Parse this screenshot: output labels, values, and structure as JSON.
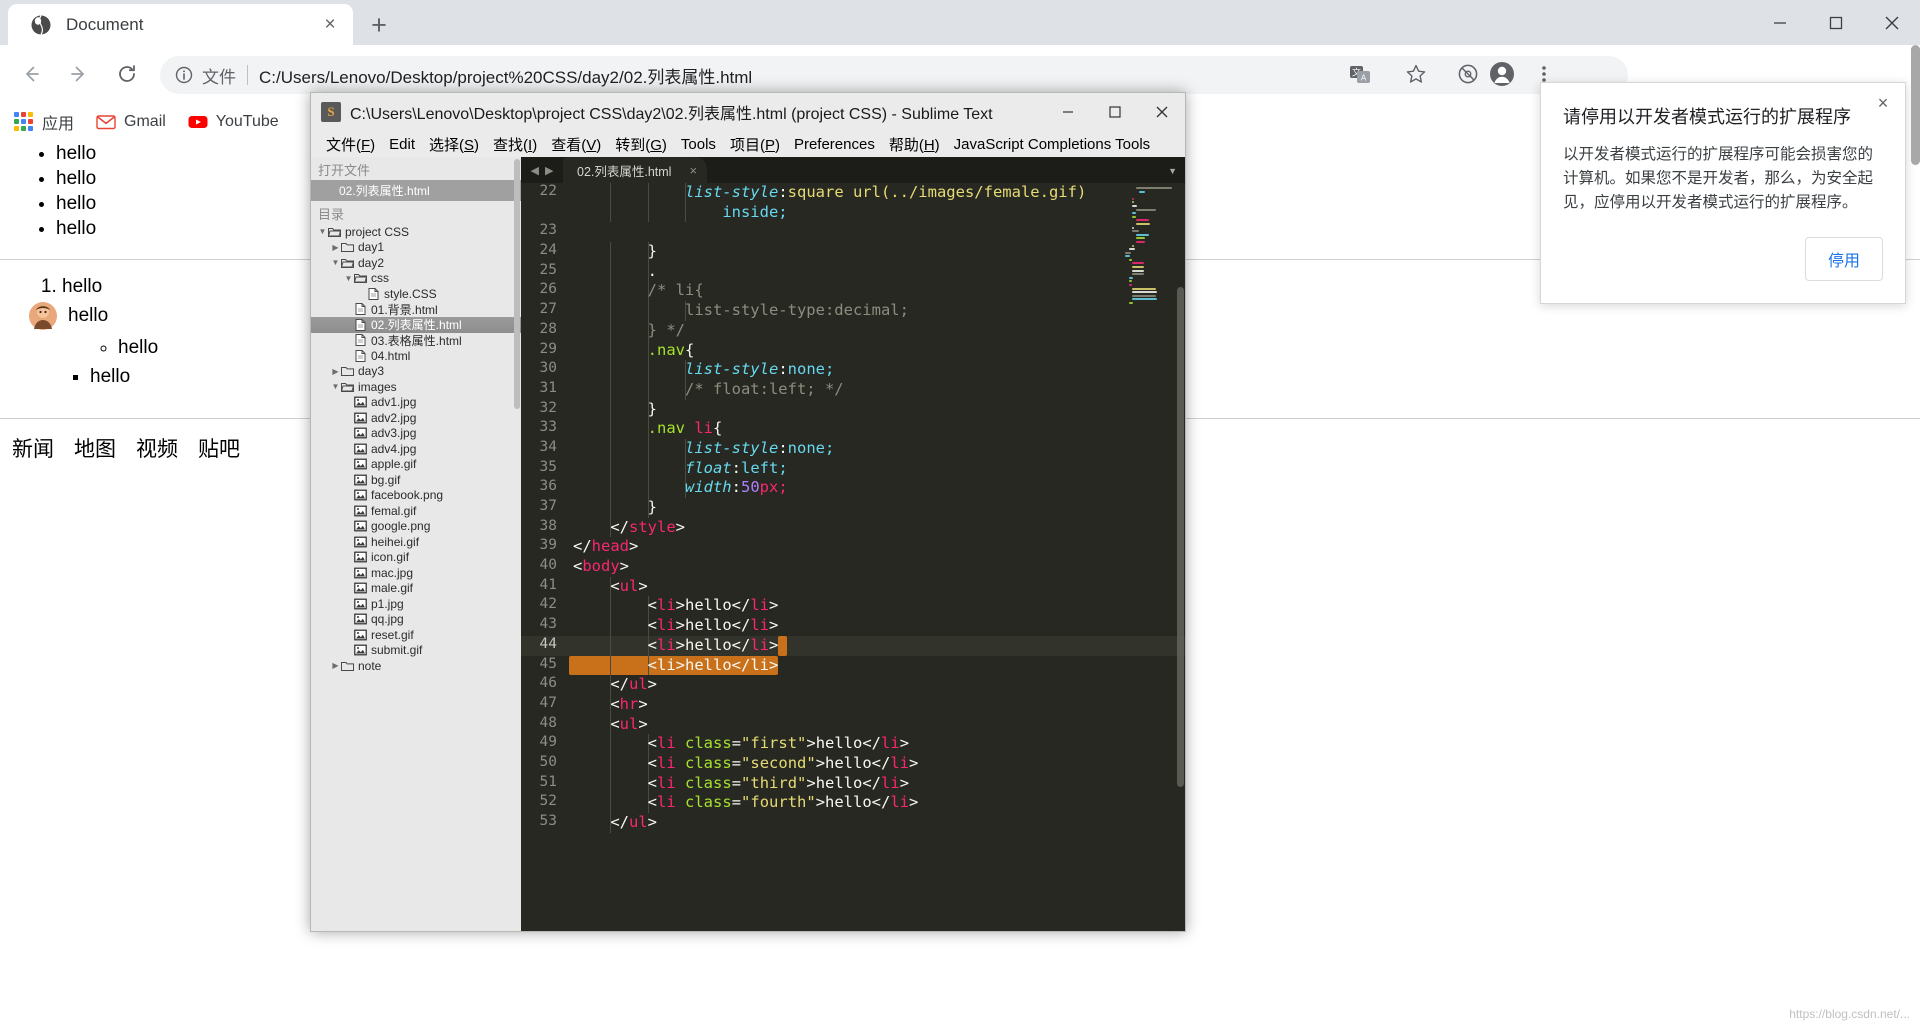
{
  "browser": {
    "tab": {
      "title": "Document",
      "favicon": "globe-icon",
      "close": "×"
    },
    "newtab": "+",
    "window_controls": {
      "minimize": "minimize-icon",
      "maximize": "maximize-icon",
      "close": "close-icon"
    },
    "nav": {
      "back": "back-arrow-icon",
      "forward": "forward-arrow-icon",
      "reload": "reload-icon"
    },
    "omnibox": {
      "info_icon": "info-circle-icon",
      "scheme_label": "文件",
      "url": "C:/Users/Lenovo/Desktop/project%20CSS/day2/02.列表属性.html"
    },
    "toolbar_icons": [
      "translate-icon",
      "star-icon",
      "extension-blocked-icon",
      "profile-icon",
      "more-menu-icon"
    ],
    "bookmarks": [
      {
        "label": "应用",
        "icon": "apps-grid-icon"
      },
      {
        "label": "Gmail",
        "icon": "gmail-icon"
      },
      {
        "label": "YouTube",
        "icon": "youtube-icon"
      }
    ]
  },
  "page": {
    "list1": [
      "hello",
      "hello",
      "hello",
      "hello"
    ],
    "ordered": [
      "hello"
    ],
    "avatar_item": "hello",
    "circle_list": [
      "hello"
    ],
    "square_list": [
      "hello"
    ],
    "nav_items": [
      "新闻",
      "地图",
      "视频",
      "贴吧"
    ]
  },
  "sublime": {
    "title": "C:\\Users\\Lenovo\\Desktop\\project CSS\\day2\\02.列表属性.html (project CSS) - Sublime Text",
    "logo_glyph": "S",
    "window_controls": {
      "minimize": "minimize-icon",
      "maximize": "maximize-icon",
      "close": "close-icon"
    },
    "menu": [
      "文件(F)",
      "Edit",
      "选择(S)",
      "查找(I)",
      "查看(V)",
      "转到(G)",
      "Tools",
      "项目(P)",
      "Preferences",
      "帮助(H)",
      "JavaScript Completions Tools"
    ],
    "sidebar": {
      "open_files_header": "打开文件",
      "open_files": [
        "02.列表属性.html"
      ],
      "folders_header": "目录",
      "tree": [
        {
          "label": "project CSS",
          "depth": 0,
          "type": "folder",
          "state": "open"
        },
        {
          "label": "day1",
          "depth": 1,
          "type": "folder",
          "state": "closed"
        },
        {
          "label": "day2",
          "depth": 1,
          "type": "folder",
          "state": "open"
        },
        {
          "label": "css",
          "depth": 2,
          "type": "folder",
          "state": "open"
        },
        {
          "label": "style.CSS",
          "depth": 3,
          "type": "file"
        },
        {
          "label": "01.背景.html",
          "depth": 2,
          "type": "file"
        },
        {
          "label": "02.列表属性.html",
          "depth": 2,
          "type": "file",
          "selected": true
        },
        {
          "label": "03.表格属性.html",
          "depth": 2,
          "type": "file"
        },
        {
          "label": "04.html",
          "depth": 2,
          "type": "file"
        },
        {
          "label": "day3",
          "depth": 1,
          "type": "folder",
          "state": "closed"
        },
        {
          "label": "images",
          "depth": 1,
          "type": "folder",
          "state": "open"
        },
        {
          "label": "adv1.jpg",
          "depth": 2,
          "type": "image"
        },
        {
          "label": "adv2.jpg",
          "depth": 2,
          "type": "image"
        },
        {
          "label": "adv3.jpg",
          "depth": 2,
          "type": "image"
        },
        {
          "label": "adv4.jpg",
          "depth": 2,
          "type": "image"
        },
        {
          "label": "apple.gif",
          "depth": 2,
          "type": "image"
        },
        {
          "label": "bg.gif",
          "depth": 2,
          "type": "image"
        },
        {
          "label": "facebook.png",
          "depth": 2,
          "type": "image"
        },
        {
          "label": "femal.gif",
          "depth": 2,
          "type": "image"
        },
        {
          "label": "google.png",
          "depth": 2,
          "type": "image"
        },
        {
          "label": "heihei.gif",
          "depth": 2,
          "type": "image"
        },
        {
          "label": "icon.gif",
          "depth": 2,
          "type": "image"
        },
        {
          "label": "mac.jpg",
          "depth": 2,
          "type": "image"
        },
        {
          "label": "male.gif",
          "depth": 2,
          "type": "image"
        },
        {
          "label": "p1.jpg",
          "depth": 2,
          "type": "image"
        },
        {
          "label": "qq.jpg",
          "depth": 2,
          "type": "image"
        },
        {
          "label": "reset.gif",
          "depth": 2,
          "type": "image"
        },
        {
          "label": "submit.gif",
          "depth": 2,
          "type": "image"
        },
        {
          "label": "note",
          "depth": 1,
          "type": "folder",
          "state": "closed"
        }
      ]
    },
    "editor_tab": {
      "label": "02.列表属性.html",
      "close": "×"
    },
    "code": {
      "first_line_number": 22,
      "cursor_line": 44,
      "selected_line": 45,
      "lines": [
        {
          "n": 22,
          "tokens": [
            {
              "t": "            ",
              "c": "t-plain"
            },
            {
              "t": "list-style",
              "c": "t-prop"
            },
            {
              "t": ":",
              "c": "t-punct"
            },
            {
              "t": "square url(../images/female.gif)",
              "c": "t-yellow"
            }
          ]
        },
        {
          "n": "",
          "tokens": [
            {
              "t": "                ",
              "c": "t-plain"
            },
            {
              "t": "inside;",
              "c": "t-val"
            }
          ]
        },
        {
          "n": 23,
          "tokens": []
        },
        {
          "n": 24,
          "tokens": [
            {
              "t": "        }",
              "c": "t-plain"
            }
          ]
        },
        {
          "n": 25,
          "tokens": [
            {
              "t": "        .",
              "c": "t-plain"
            }
          ]
        },
        {
          "n": 26,
          "tokens": [
            {
              "t": "        /* li{",
              "c": "t-comment"
            }
          ]
        },
        {
          "n": 27,
          "tokens": [
            {
              "t": "            list-style-type:decimal;",
              "c": "t-comment"
            }
          ]
        },
        {
          "n": 28,
          "tokens": [
            {
              "t": "        } */",
              "c": "t-comment"
            }
          ]
        },
        {
          "n": 29,
          "tokens": [
            {
              "t": "        .nav",
              "c": "t-sel"
            },
            {
              "t": "{",
              "c": "t-plain"
            }
          ]
        },
        {
          "n": 30,
          "tokens": [
            {
              "t": "            ",
              "c": "t-plain"
            },
            {
              "t": "list-style",
              "c": "t-prop"
            },
            {
              "t": ":",
              "c": "t-punct"
            },
            {
              "t": "none;",
              "c": "t-val"
            }
          ]
        },
        {
          "n": 31,
          "tokens": [
            {
              "t": "            /* float:left; */",
              "c": "t-comment"
            }
          ]
        },
        {
          "n": 32,
          "tokens": [
            {
              "t": "        }",
              "c": "t-plain"
            }
          ]
        },
        {
          "n": 33,
          "tokens": [
            {
              "t": "        .nav ",
              "c": "t-sel"
            },
            {
              "t": "li",
              "c": "t-tag"
            },
            {
              "t": "{",
              "c": "t-plain"
            }
          ]
        },
        {
          "n": 34,
          "tokens": [
            {
              "t": "            ",
              "c": "t-plain"
            },
            {
              "t": "list-style",
              "c": "t-prop"
            },
            {
              "t": ":",
              "c": "t-punct"
            },
            {
              "t": "none;",
              "c": "t-val"
            }
          ]
        },
        {
          "n": 35,
          "tokens": [
            {
              "t": "            ",
              "c": "t-plain"
            },
            {
              "t": "float",
              "c": "t-prop"
            },
            {
              "t": ":",
              "c": "t-punct"
            },
            {
              "t": "left;",
              "c": "t-val"
            }
          ]
        },
        {
          "n": 36,
          "tokens": [
            {
              "t": "            ",
              "c": "t-plain"
            },
            {
              "t": "width",
              "c": "t-prop"
            },
            {
              "t": ":",
              "c": "t-punct"
            },
            {
              "t": "50",
              "c": "t-num"
            },
            {
              "t": "px;",
              "c": "t-tag"
            }
          ]
        },
        {
          "n": 37,
          "tokens": [
            {
              "t": "        }",
              "c": "t-plain"
            }
          ]
        },
        {
          "n": 38,
          "tokens": [
            {
              "t": "    </",
              "c": "t-plain"
            },
            {
              "t": "style",
              "c": "t-tag"
            },
            {
              "t": ">",
              "c": "t-plain"
            }
          ]
        },
        {
          "n": 39,
          "tokens": [
            {
              "t": "</",
              "c": "t-plain"
            },
            {
              "t": "head",
              "c": "t-tag"
            },
            {
              "t": ">",
              "c": "t-plain"
            }
          ]
        },
        {
          "n": 40,
          "tokens": [
            {
              "t": "<",
              "c": "t-plain"
            },
            {
              "t": "body",
              "c": "t-tag"
            },
            {
              "t": ">",
              "c": "t-plain"
            }
          ]
        },
        {
          "n": 41,
          "tokens": [
            {
              "t": "    <",
              "c": "t-plain"
            },
            {
              "t": "ul",
              "c": "t-tag"
            },
            {
              "t": ">",
              "c": "t-plain"
            }
          ]
        },
        {
          "n": 42,
          "tokens": [
            {
              "t": "        <",
              "c": "t-plain"
            },
            {
              "t": "li",
              "c": "t-tag"
            },
            {
              "t": ">hello</",
              "c": "t-plain"
            },
            {
              "t": "li",
              "c": "t-tag"
            },
            {
              "t": ">",
              "c": "t-plain"
            }
          ]
        },
        {
          "n": 43,
          "tokens": [
            {
              "t": "        <",
              "c": "t-plain"
            },
            {
              "t": "li",
              "c": "t-tag"
            },
            {
              "t": ">hello</",
              "c": "t-plain"
            },
            {
              "t": "li",
              "c": "t-tag"
            },
            {
              "t": ">",
              "c": "t-plain"
            }
          ]
        },
        {
          "n": 44,
          "tokens": [
            {
              "t": "        <",
              "c": "t-plain"
            },
            {
              "t": "li",
              "c": "t-tag"
            },
            {
              "t": ">hello</",
              "c": "t-plain"
            },
            {
              "t": "li",
              "c": "t-tag"
            },
            {
              "t": ">",
              "c": "t-plain"
            }
          ]
        },
        {
          "n": 45,
          "tokens": [
            {
              "t": "        <",
              "c": "t-plain"
            },
            {
              "t": "li",
              "c": "t-plain"
            },
            {
              "t": ">hello</",
              "c": "t-plain"
            },
            {
              "t": "li",
              "c": "t-plain"
            },
            {
              "t": ">",
              "c": "t-plain"
            }
          ]
        },
        {
          "n": 46,
          "tokens": [
            {
              "t": "    </",
              "c": "t-plain"
            },
            {
              "t": "ul",
              "c": "t-tag"
            },
            {
              "t": ">",
              "c": "t-plain"
            }
          ]
        },
        {
          "n": 47,
          "tokens": [
            {
              "t": "    <",
              "c": "t-plain"
            },
            {
              "t": "hr",
              "c": "t-tag"
            },
            {
              "t": ">",
              "c": "t-plain"
            }
          ]
        },
        {
          "n": 48,
          "tokens": [
            {
              "t": "    <",
              "c": "t-plain"
            },
            {
              "t": "ul",
              "c": "t-tag"
            },
            {
              "t": ">",
              "c": "t-plain"
            }
          ]
        },
        {
          "n": 49,
          "tokens": [
            {
              "t": "        <",
              "c": "t-plain"
            },
            {
              "t": "li",
              "c": "t-tag"
            },
            {
              "t": " ",
              "c": "t-plain"
            },
            {
              "t": "class",
              "c": "t-attr"
            },
            {
              "t": "=",
              "c": "t-plain"
            },
            {
              "t": "\"first\"",
              "c": "t-str"
            },
            {
              "t": ">hello</",
              "c": "t-plain"
            },
            {
              "t": "li",
              "c": "t-tag"
            },
            {
              "t": ">",
              "c": "t-plain"
            }
          ]
        },
        {
          "n": 50,
          "tokens": [
            {
              "t": "        <",
              "c": "t-plain"
            },
            {
              "t": "li",
              "c": "t-tag"
            },
            {
              "t": " ",
              "c": "t-plain"
            },
            {
              "t": "class",
              "c": "t-attr"
            },
            {
              "t": "=",
              "c": "t-plain"
            },
            {
              "t": "\"second\"",
              "c": "t-str"
            },
            {
              "t": ">hello</",
              "c": "t-plain"
            },
            {
              "t": "li",
              "c": "t-tag"
            },
            {
              "t": ">",
              "c": "t-plain"
            }
          ]
        },
        {
          "n": 51,
          "tokens": [
            {
              "t": "        <",
              "c": "t-plain"
            },
            {
              "t": "li",
              "c": "t-tag"
            },
            {
              "t": " ",
              "c": "t-plain"
            },
            {
              "t": "class",
              "c": "t-attr"
            },
            {
              "t": "=",
              "c": "t-plain"
            },
            {
              "t": "\"third\"",
              "c": "t-str"
            },
            {
              "t": ">hello</",
              "c": "t-plain"
            },
            {
              "t": "li",
              "c": "t-tag"
            },
            {
              "t": ">",
              "c": "t-plain"
            }
          ]
        },
        {
          "n": 52,
          "tokens": [
            {
              "t": "        <",
              "c": "t-plain"
            },
            {
              "t": "li",
              "c": "t-tag"
            },
            {
              "t": " ",
              "c": "t-plain"
            },
            {
              "t": "class",
              "c": "t-attr"
            },
            {
              "t": "=",
              "c": "t-plain"
            },
            {
              "t": "\"fourth\"",
              "c": "t-str"
            },
            {
              "t": ">hello</",
              "c": "t-plain"
            },
            {
              "t": "li",
              "c": "t-tag"
            },
            {
              "t": ">",
              "c": "t-plain"
            }
          ]
        },
        {
          "n": 53,
          "tokens": [
            {
              "t": "    </",
              "c": "t-plain"
            },
            {
              "t": "ul",
              "c": "t-tag"
            },
            {
              "t": ">",
              "c": "t-plain"
            }
          ]
        }
      ]
    }
  },
  "notification": {
    "title": "请停用以开发者模式运行的扩展程序",
    "body": "以开发者模式运行的扩展程序可能会损害您的计算机。如果您不是开发者，那么，为安全起见，应停用以开发者模式运行的扩展程序。",
    "button": "停用",
    "close": "×"
  },
  "watermark": "https://blog.csdn.net/..."
}
